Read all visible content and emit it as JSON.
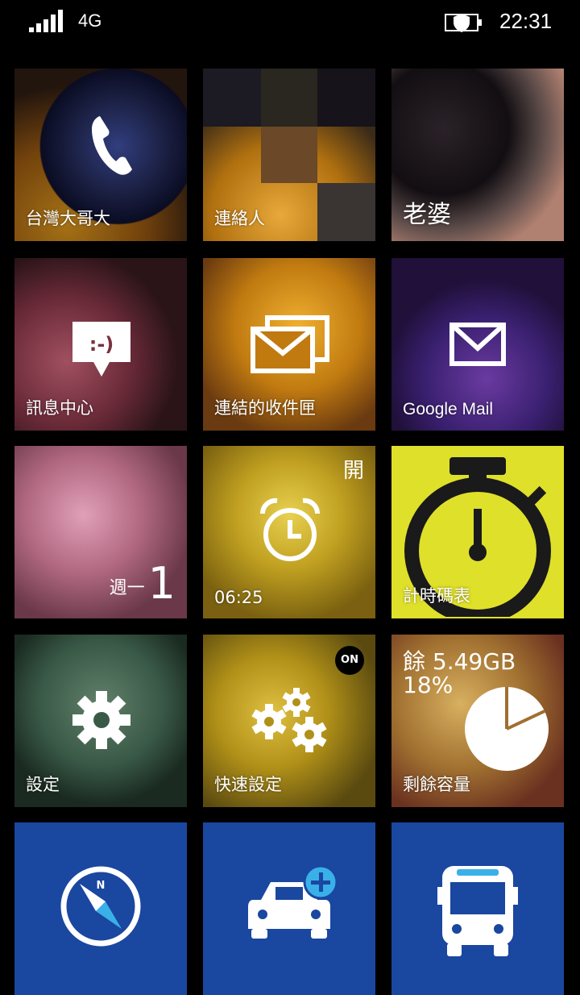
{
  "status_bar": {
    "network": "4G",
    "time": "22:31",
    "signal_icon": "signal-bars-icon",
    "battery_icon": "battery-saver-icon"
  },
  "tiles": {
    "phone": {
      "label": "台灣大哥大",
      "icon": "phone-icon"
    },
    "contacts": {
      "label": "連絡人"
    },
    "wife": {
      "label": "老婆"
    },
    "messaging": {
      "label": "訊息中心",
      "icon": "message-bubble-icon"
    },
    "linked_inbox": {
      "label": "連結的收件匣",
      "icon": "linked-inbox-icon"
    },
    "google_mail": {
      "label": "Google Mail",
      "icon": "mail-icon"
    },
    "calendar": {
      "day_name": "週一",
      "day_number": "1"
    },
    "alarms": {
      "label": "06:25",
      "status": "開",
      "icon": "alarm-clock-icon"
    },
    "stopwatch": {
      "label": "計時碼表",
      "icon": "stopwatch-icon",
      "bg_color": "#DFE02A"
    },
    "settings": {
      "label": "設定",
      "icon": "gear-icon"
    },
    "quick_settings": {
      "label": "快速設定",
      "badge": "ON",
      "icon": "gears-icon"
    },
    "storage": {
      "label": "剩餘容量",
      "free": "餘 5.49GB",
      "percent": "18%",
      "used_fraction": 0.18,
      "icon": "pie-chart-icon"
    },
    "compass": {
      "icon": "compass-icon",
      "bg_color": "#1A47A0"
    },
    "car": {
      "icon": "car-add-icon",
      "bg_color": "#1A47A0"
    },
    "bus": {
      "icon": "bus-icon",
      "bg_color": "#1A47A0"
    }
  }
}
